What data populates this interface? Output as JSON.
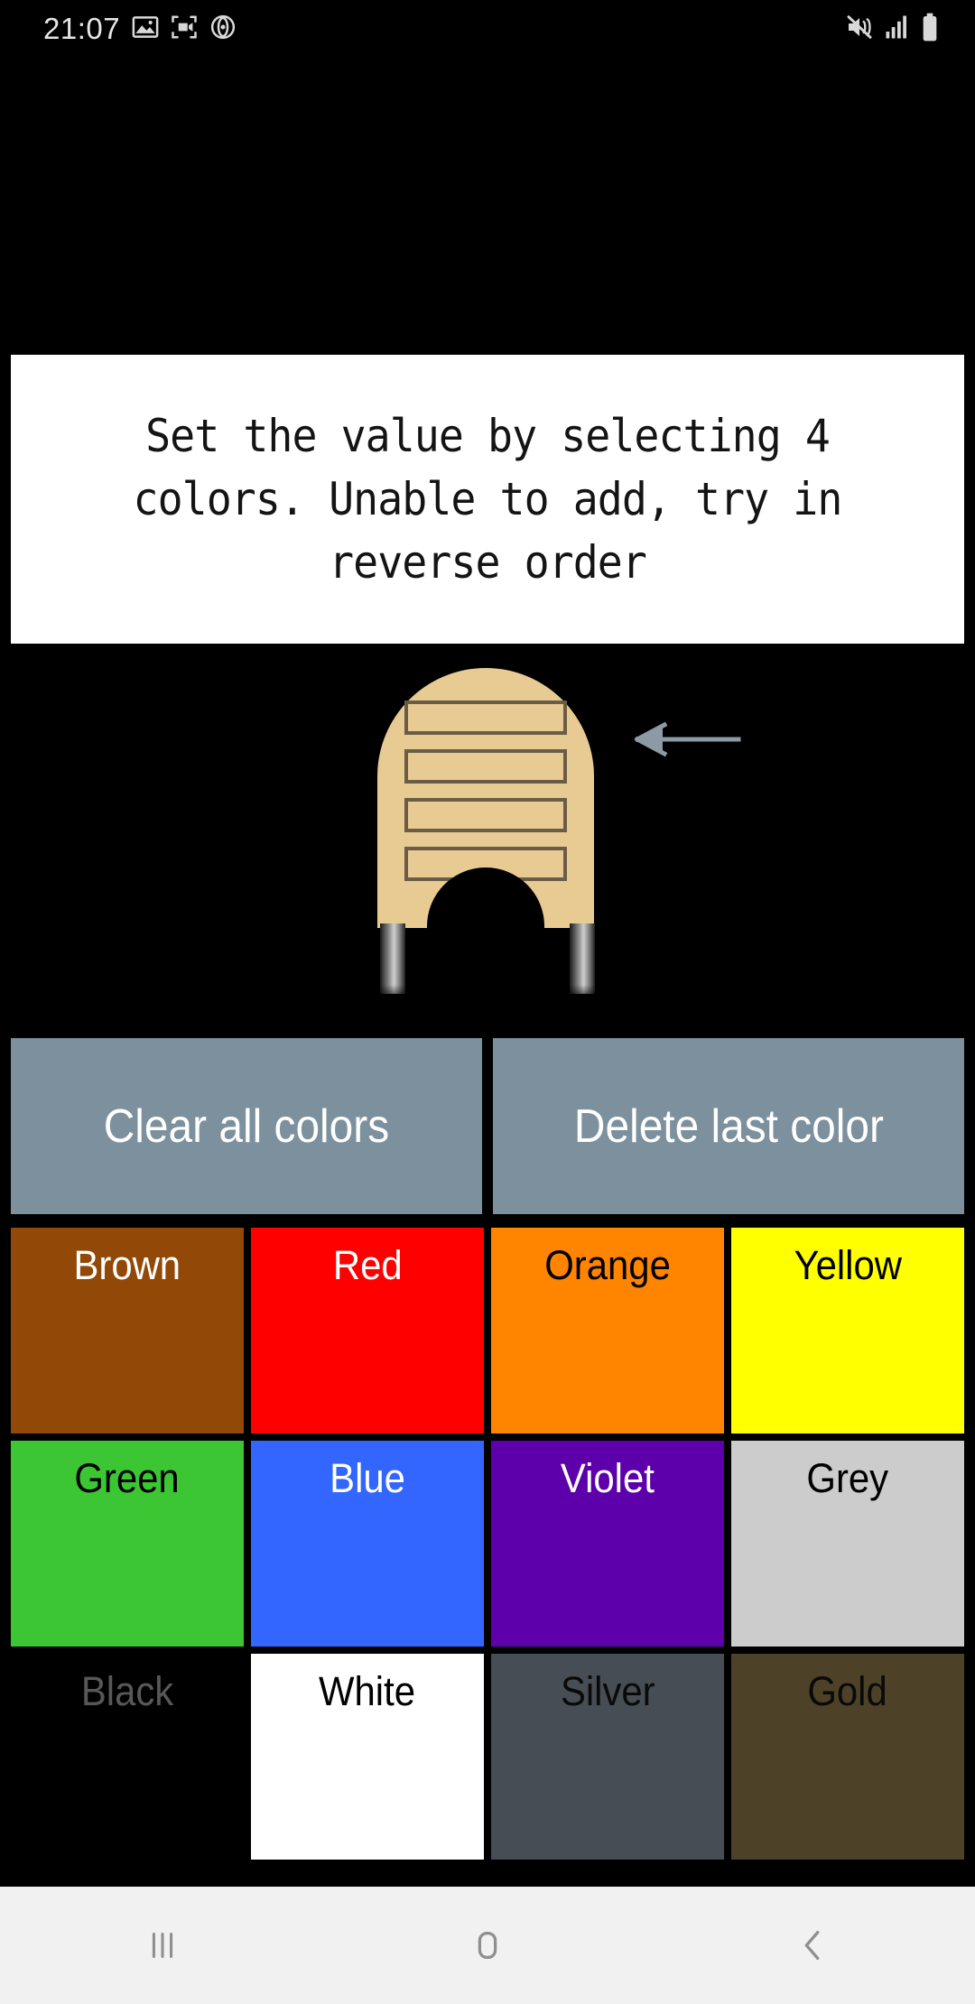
{
  "status_bar": {
    "time": "21:07",
    "left_icons": [
      "image-icon",
      "screenshot-capture-icon",
      "screen-record-icon"
    ],
    "right_icons": [
      "mute-icon",
      "signal-bars-icon",
      "battery-icon"
    ]
  },
  "message": {
    "text": "Set the value by selecting 4 colors. Unable to add, try in reverse order",
    "background": "#ffffff",
    "text_color": "#141414"
  },
  "resistor": {
    "name": "resistor-diagram",
    "body_color": "#e8cb92",
    "band_outline_color": "#6b5c47",
    "band_count": 4,
    "bands": [
      "empty",
      "empty",
      "empty",
      "empty"
    ],
    "pointer_icon": "arrow-left-icon",
    "pointer_color": "#8c9aa6"
  },
  "actions": {
    "clear_label": "Clear all colors",
    "delete_label": "Delete last color",
    "button_color": "#7c919d",
    "button_text_color": "#ffffff"
  },
  "palette": {
    "colors": [
      {
        "label": "Brown",
        "bg": "#924806",
        "fg": "#ffffff"
      },
      {
        "label": "Red",
        "bg": "#fe0000",
        "fg": "#ffffff"
      },
      {
        "label": "Orange",
        "bg": "#ff8400",
        "fg": "#000000"
      },
      {
        "label": "Yellow",
        "bg": "#ffff00",
        "fg": "#000000"
      },
      {
        "label": "Green",
        "bg": "#3cc634",
        "fg": "#000000"
      },
      {
        "label": "Blue",
        "bg": "#3366fe",
        "fg": "#ffffff"
      },
      {
        "label": "Violet",
        "bg": "#5d00ab",
        "fg": "#ffffff"
      },
      {
        "label": "Grey",
        "bg": "#cccccc",
        "fg": "#000000"
      },
      {
        "label": "Black",
        "bg": "#000000",
        "fg": "#585858"
      },
      {
        "label": "White",
        "bg": "#ffffff",
        "fg": "#000000"
      },
      {
        "label": "Silver",
        "bg": "#474d55",
        "fg": "#0a0a0a"
      },
      {
        "label": "Gold",
        "bg": "#4d4228",
        "fg": "#0a0a0a"
      }
    ]
  },
  "nav_bar": {
    "background": "#f1f1f1",
    "icon_color": "#8f8f8f",
    "buttons": [
      {
        "name": "recents-icon",
        "label": "Recents"
      },
      {
        "name": "home-icon",
        "label": "Home"
      },
      {
        "name": "back-icon",
        "label": "Back"
      }
    ]
  }
}
